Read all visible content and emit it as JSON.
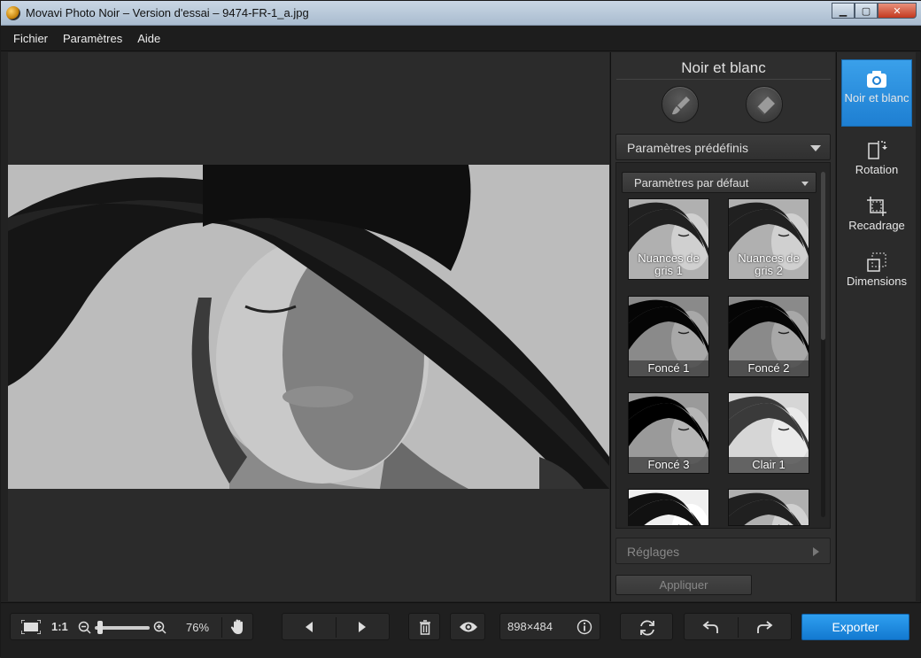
{
  "window": {
    "title": "Movavi Photo Noir – Version d'essai – 9474-FR-1_a.jpg"
  },
  "menu": {
    "items": [
      "Fichier",
      "Paramètres",
      "Aide"
    ]
  },
  "panel": {
    "title": "Noir et blanc",
    "tool_icons": [
      "brush-icon",
      "eraser-icon"
    ],
    "presets_section": "Paramètres prédéfinis",
    "preset_select": "Paramètres par défaut",
    "presets": [
      {
        "label": "Nuances de gris 1",
        "tone": "gray"
      },
      {
        "label": "Nuances de gris 2",
        "tone": "gray"
      },
      {
        "label": "Foncé 1",
        "tone": "dark"
      },
      {
        "label": "Foncé 2",
        "tone": "dark"
      },
      {
        "label": "Foncé 3",
        "tone": "darker"
      },
      {
        "label": "Clair 1",
        "tone": "light"
      },
      {
        "label": "",
        "tone": "bright"
      },
      {
        "label": "",
        "tone": "gray"
      }
    ],
    "adjust_section": "Réglages",
    "apply_label": "Appliquer"
  },
  "tools": [
    {
      "label": "Noir et blanc",
      "icon": "camera-icon",
      "active": true
    },
    {
      "label": "Rotation",
      "icon": "rotate-icon",
      "active": false
    },
    {
      "label": "Recadrage",
      "icon": "crop-icon",
      "active": false
    },
    {
      "label": "Dimensions",
      "icon": "resize-icon",
      "active": false
    }
  ],
  "bottom": {
    "ratio_label": "1:1",
    "zoom_value": "76%",
    "zoom_fraction": 0.06,
    "image_size": "898×484",
    "export_label": "Exporter"
  },
  "colors": {
    "accent": "#1e86d8",
    "panel": "#2e2e2e",
    "background": "#222222"
  }
}
